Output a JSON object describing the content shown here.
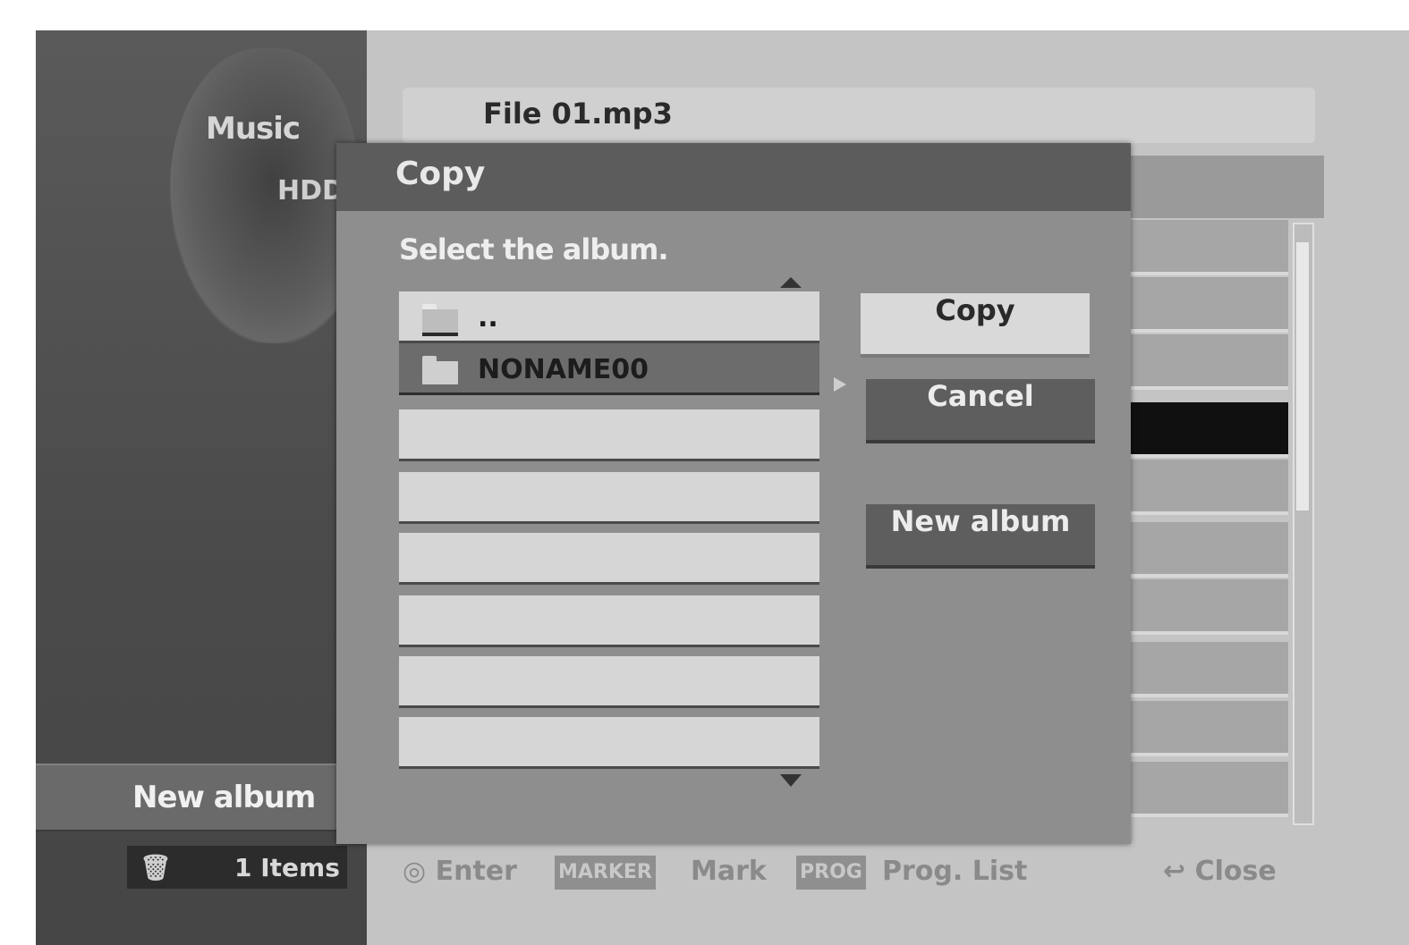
{
  "left_panel": {
    "section_title": "Music",
    "source_label": "HDD",
    "new_album_label": "New album",
    "item_count": "1 Items",
    "trash_icon": "trash-icon"
  },
  "file_bar": {
    "filename": "File 01.mp3"
  },
  "dialog": {
    "title": "Copy",
    "prompt": "Select the album.",
    "albums": [
      {
        "label": "..",
        "icon": "folder-up-icon",
        "selected": false
      },
      {
        "label": "NONAME00",
        "icon": "folder-icon",
        "selected": true
      },
      {
        "label": "",
        "selected": false
      },
      {
        "label": "",
        "selected": false
      },
      {
        "label": "",
        "selected": false
      },
      {
        "label": "",
        "selected": false
      },
      {
        "label": "",
        "selected": false
      },
      {
        "label": "",
        "selected": false
      }
    ],
    "buttons": {
      "copy": "Copy",
      "cancel": "Cancel",
      "new_album": "New album"
    }
  },
  "footer": {
    "enter_label": "Enter",
    "mark_key": "MARKER",
    "mark_label": "Mark",
    "prog_key": "PROG",
    "prog_label": "Prog. List",
    "close_label": "Close"
  },
  "colors": {
    "dialog_bg": "#8e8e8e",
    "titlebar": "#5c5c5c",
    "selected_row": "#6c6c6c",
    "list_row": "#d6d6d6"
  }
}
